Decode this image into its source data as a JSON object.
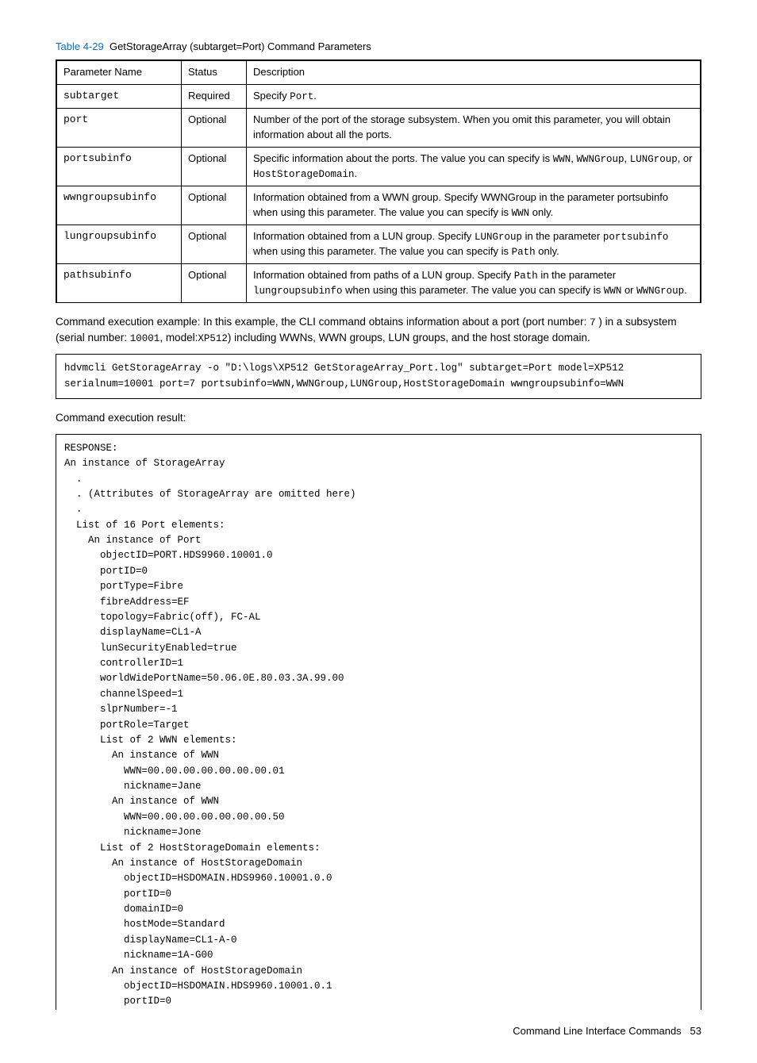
{
  "caption": {
    "label": "Table 4-29",
    "title": "GetStorageArray (subtarget=Port) Command Parameters"
  },
  "headers": {
    "c0": "Parameter Name",
    "c1": "Status",
    "c2": "Description"
  },
  "rows": [
    {
      "name": "subtarget",
      "status": "Required",
      "desc_pre": "Specify ",
      "desc_code": "Port",
      "desc_post": "."
    },
    {
      "name": "port",
      "status": "Optional",
      "desc_plain": "Number of the port of the storage subsystem. When you omit this parameter, you will obtain information about all the ports."
    },
    {
      "name": "portsubinfo",
      "status": "Optional",
      "desc_html": "Specific information about the ports. The value you can specify is <code>WWN</code>, <code>WWNGroup</code>, <code>LUNGroup</code>, or <code>HostStorageDomain</code>."
    },
    {
      "name": "wwngroupsubinfo",
      "status": "Optional",
      "desc_html": "Information obtained from a WWN group. Specify WWNGroup in the parameter portsubinfo when using this parameter. The value you can specify is <code>WWN</code> only."
    },
    {
      "name": "lungroupsubinfo",
      "status": "Optional",
      "desc_html": "Information obtained from a LUN group. Specify <code>LUNGroup</code> in the parameter <code>portsubinfo</code> when using this parameter. The value you can specify is <code>Path</code> only."
    },
    {
      "name": "pathsubinfo",
      "status": "Optional",
      "desc_html": "Information obtained from paths of a LUN group. Specify <code>Path</code> in the parameter <code>lungroupsubinfo</code> when using this parameter. The value you can specify is <code>WWN</code> or <code>WWNGroup</code>."
    }
  ],
  "example": {
    "lead": "Command execution example: In this example, the CLI command obtains information about a port (port number: ",
    "num": "7",
    "mid1": " ) in a subsystem (serial number: ",
    "serial": "10001",
    "mid2": ", model:",
    "model": "XP512",
    "tail": ") including WWNs, WWN groups, LUN groups, and the host storage domain."
  },
  "cmd": "hdvmcli GetStorageArray -o \"D:\\logs\\XP512 GetStorageArray_Port.log\" subtarget=Port model=XP512 serialnum=10001 port=7 portsubinfo=WWN,WWNGroup,LUNGroup,HostStorageDomain wwngroupsubinfo=WWN",
  "result_label": "Command execution result:",
  "result": "RESPONSE:\nAn instance of StorageArray\n  .\n  . (Attributes of StorageArray are omitted here)\n  .\n  List of 16 Port elements:\n    An instance of Port\n      objectID=PORT.HDS9960.10001.0\n      portID=0\n      portType=Fibre\n      fibreAddress=EF\n      topology=Fabric(off), FC-AL\n      displayName=CL1-A\n      lunSecurityEnabled=true\n      controllerID=1\n      worldWidePortName=50.06.0E.80.03.3A.99.00\n      channelSpeed=1\n      slprNumber=-1\n      portRole=Target\n      List of 2 WWN elements:\n        An instance of WWN\n          WWN=00.00.00.00.00.00.00.01\n          nickname=Jane\n        An instance of WWN\n          WWN=00.00.00.00.00.00.00.50\n          nickname=Jone\n      List of 2 HostStorageDomain elements:\n        An instance of HostStorageDomain\n          objectID=HSDOMAIN.HDS9960.10001.0.0\n          portID=0\n          domainID=0\n          hostMode=Standard\n          displayName=CL1-A-0\n          nickname=1A-G00\n        An instance of HostStorageDomain\n          objectID=HSDOMAIN.HDS9960.10001.0.1\n          portID=0",
  "footer": {
    "title": "Command Line Interface Commands",
    "page": "53"
  }
}
